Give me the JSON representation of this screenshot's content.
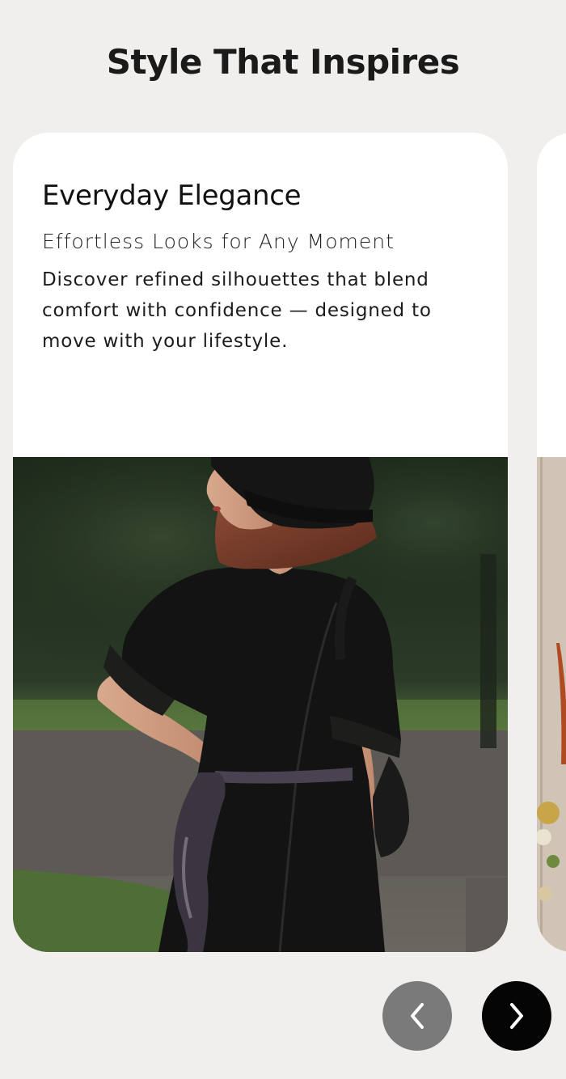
{
  "section": {
    "title": "Style That Inspires"
  },
  "cards": [
    {
      "heading": "Everyday Elegance",
      "subheading": "Effortless Looks for Any Moment",
      "description": "Discover refined silhouettes that blend comfort with confidence — designed to move with your lifestyle.",
      "image_alt": "Woman in black dress and bucket hat outdoors"
    }
  ],
  "controls": {
    "prev_icon": "chevron-left-icon",
    "next_icon": "chevron-right-icon",
    "prev_color": "#7a7a7a",
    "next_color": "#050505"
  }
}
